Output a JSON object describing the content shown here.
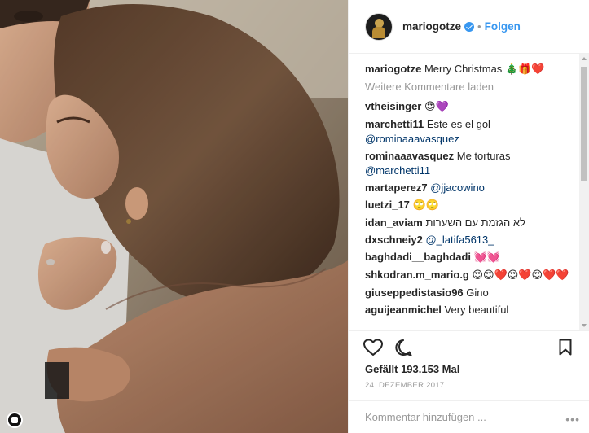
{
  "post": {
    "username": "mariogotze",
    "follow_label": "Folgen",
    "separator": "•"
  },
  "caption": {
    "username": "mariogotze",
    "text": "Merry Christmas",
    "emoji": "🎄🎁❤️"
  },
  "load_more_label": "Weitere Kommentare laden",
  "comments": [
    {
      "user": "vtheisinger",
      "text": "",
      "mention": "",
      "emoji": "😍💜"
    },
    {
      "user": "marchetti11",
      "text": "Este es el gol",
      "mention": "@rominaaavasquez",
      "emoji": ""
    },
    {
      "user": "rominaaavasquez",
      "text": "Me torturas",
      "mention": "@marchetti11",
      "emoji": ""
    },
    {
      "user": "martaperez7",
      "text": "",
      "mention": "@jjacowino",
      "emoji": ""
    },
    {
      "user": "luetzi_17",
      "text": "",
      "mention": "",
      "emoji": "🙄🙄"
    },
    {
      "user": "idan_aviam",
      "text": "לא הגזמת עם השערות",
      "mention": "",
      "emoji": ""
    },
    {
      "user": "dxschneiy2",
      "text": "",
      "mention": "@_latifa5613_",
      "emoji": ""
    },
    {
      "user": "baghdadi__baghdadi",
      "text": "",
      "mention": "",
      "emoji": "💓💓"
    },
    {
      "user": "shkodran.m_mario.g",
      "text": "",
      "mention": "",
      "emoji": "😍😍❤️😍❤️😍❤️❤️"
    },
    {
      "user": "giuseppedistasio96",
      "text": "Gino",
      "mention": "",
      "emoji": ""
    },
    {
      "user": "aguijeanmichel",
      "text": "Very beautiful",
      "mention": "",
      "emoji": ""
    }
  ],
  "likes_text": "Gefällt 193.153 Mal",
  "date_text": "24. DEZEMBER 2017",
  "add_comment_placeholder": "Kommentar hinzufügen ...",
  "more_options": "•••",
  "icons": {
    "like": "heart-icon",
    "comment": "comment-icon",
    "save": "bookmark-icon",
    "verified": "verified-badge-icon"
  },
  "colors": {
    "link": "#3897f0",
    "verified": "#3897f0",
    "text": "#262626",
    "muted": "#999999",
    "mention": "#003569"
  }
}
